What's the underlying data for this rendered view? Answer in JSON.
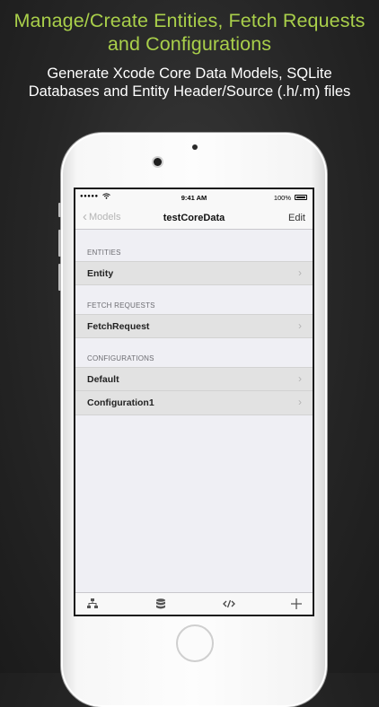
{
  "promo": {
    "headline_line1": "Manage/Create Entities, Fetch Requests",
    "headline_line2": "and Configurations",
    "subline_line1": "Generate Xcode Core Data Models, SQLite",
    "subline_line2": "Databases and Entity Header/Source (.h/.m) files",
    "headline_color": "#a9cf4a"
  },
  "status_bar": {
    "signal": "●●●●●",
    "wifi_icon": "wifi-icon",
    "time": "9:41 AM",
    "battery": "100%"
  },
  "nav": {
    "back_label": "Models",
    "title": "testCoreData",
    "edit_label": "Edit"
  },
  "sections": {
    "entities": {
      "header": "ENTITIES",
      "items": [
        {
          "label": "Entity"
        }
      ]
    },
    "fetch_requests": {
      "header": "FETCH REQUESTS",
      "items": [
        {
          "label": "FetchRequest"
        }
      ]
    },
    "configurations": {
      "header": "CONFIGURATIONS",
      "items": [
        {
          "label": "Default"
        },
        {
          "label": "Configuration1"
        }
      ]
    }
  },
  "tabbar": {
    "icons": [
      "hierarchy-icon",
      "database-icon",
      "code-icon",
      "plus-icon"
    ]
  }
}
